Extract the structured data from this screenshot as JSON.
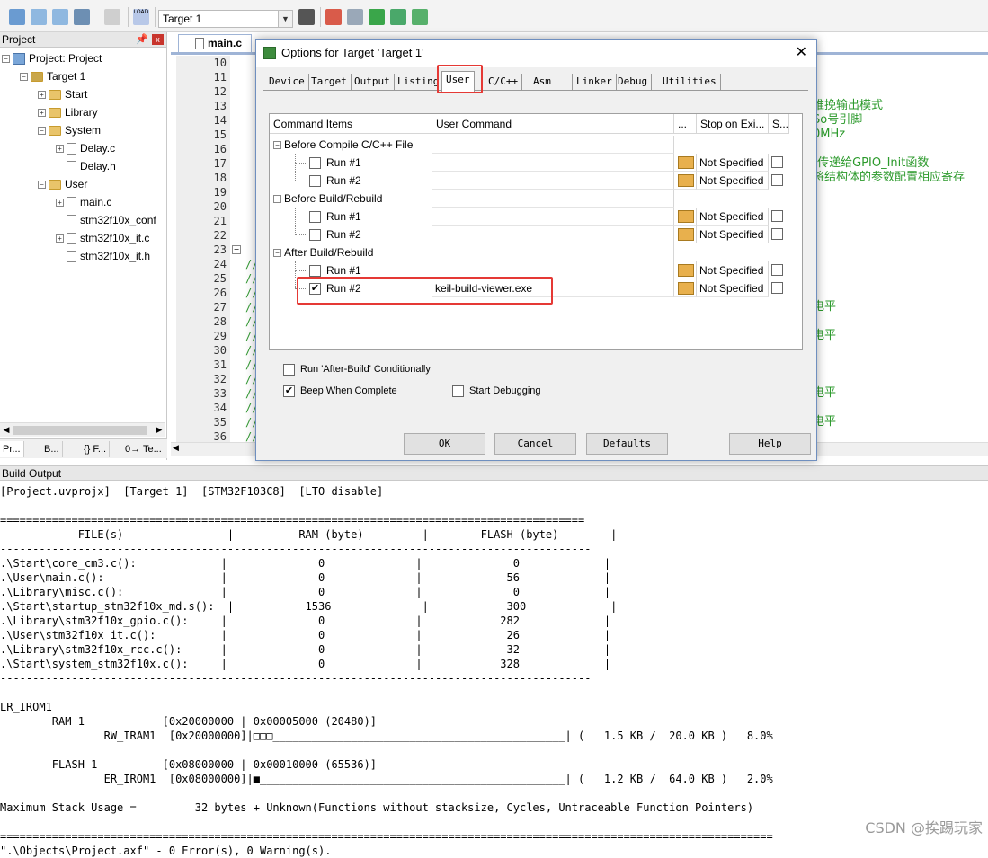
{
  "toolbar": {
    "target_value": "Target 1",
    "load_label": "LOAD"
  },
  "project_panel": {
    "title": "Project",
    "pin": "📌",
    "close": "x",
    "items": [
      {
        "label": "Project: Project",
        "expander": "−"
      },
      {
        "label": "Target 1",
        "expander": "−"
      },
      {
        "label": "Start",
        "expander": "+"
      },
      {
        "label": "Library",
        "expander": "+"
      },
      {
        "label": "System",
        "expander": "−"
      },
      {
        "label": "Delay.c",
        "expander": "+"
      },
      {
        "label": "Delay.h",
        "expander": ""
      },
      {
        "label": "User",
        "expander": "−"
      },
      {
        "label": "main.c",
        "expander": "+"
      },
      {
        "label": "stm32f10x_conf",
        "expander": ""
      },
      {
        "label": "stm32f10x_it.c",
        "expander": "+"
      },
      {
        "label": "stm32f10x_it.h",
        "expander": ""
      }
    ],
    "tabs": [
      "Pr...",
      "B...",
      "{} F...",
      "0→ Te..."
    ]
  },
  "editor": {
    "tab_label": "main.c",
    "line_numbers": [
      "10",
      "11",
      "12",
      "13",
      "14",
      "15",
      "16",
      "17",
      "18",
      "19",
      "20",
      "21",
      "22",
      "23",
      "24",
      "25",
      "26",
      "27",
      "28",
      "29",
      "30",
      "31",
      "32",
      "33",
      "34",
      "35",
      "36"
    ],
    "comment_marker": "//",
    "right_comments": [
      {
        "line": "13",
        "text": "推挽输出模式"
      },
      {
        "line": "14",
        "text": "So号引脚"
      },
      {
        "line": "15",
        "text": "0MHz"
      },
      {
        "line": "17",
        "text": "t传递给GPIO_Init函数"
      },
      {
        "line": "18",
        "text": "将结构体的参数配置相应寄存"
      },
      {
        "line": "27",
        "text": "电平"
      },
      {
        "line": "29",
        "text": "电平"
      },
      {
        "line": "33",
        "text": "电平"
      },
      {
        "line": "35",
        "text": "电平"
      }
    ]
  },
  "dialog": {
    "title": "Options for Target 'Target 1'",
    "close": "✕",
    "tabs": [
      "Device",
      "Target",
      "Output",
      "Listing",
      "User",
      "C/C++",
      "Asm",
      "Linker",
      "Debug",
      "Utilities"
    ],
    "active_tab": "User",
    "grid_headers": {
      "command_items": "Command Items",
      "user_command": "User Command",
      "dots": "...",
      "stop_on_exit": "Stop on Exi...",
      "s": "S..."
    },
    "groups": [
      {
        "label": "Before Compile C/C++ File",
        "expander": "−",
        "runs": [
          {
            "label": "Run #1",
            "checked": false,
            "command": "",
            "stop": "Not Specified"
          },
          {
            "label": "Run #2",
            "checked": false,
            "command": "",
            "stop": "Not Specified"
          }
        ]
      },
      {
        "label": "Before Build/Rebuild",
        "expander": "−",
        "runs": [
          {
            "label": "Run #1",
            "checked": false,
            "command": "",
            "stop": "Not Specified"
          },
          {
            "label": "Run #2",
            "checked": false,
            "command": "",
            "stop": "Not Specified"
          }
        ]
      },
      {
        "label": "After Build/Rebuild",
        "expander": "−",
        "runs": [
          {
            "label": "Run #1",
            "checked": false,
            "command": "",
            "stop": "Not Specified"
          },
          {
            "label": "Run #2",
            "checked": true,
            "command": "keil-build-viewer.exe",
            "stop": "Not Specified"
          }
        ]
      }
    ],
    "check_mark": "✔",
    "options": {
      "run_after_build_conditionally": {
        "label": "Run 'After-Build' Conditionally",
        "checked": false
      },
      "beep_when_complete": {
        "label": "Beep When Complete",
        "checked": true
      },
      "start_debugging": {
        "label": "Start Debugging",
        "checked": false
      }
    },
    "buttons": {
      "ok": "OK",
      "cancel": "Cancel",
      "defaults": "Defaults",
      "help": "Help"
    }
  },
  "build_output": {
    "title": "Build Output",
    "lines": [
      "[Project.uvprojx]  [Target 1]  [STM32F103C8]  [LTO disable]",
      "",
      "==========================================================================================",
      "            FILE(s)                |          RAM (byte)         |        FLASH (byte)        |",
      "-------------------------------------------------------------------------------------------",
      ".\\Start\\core_cm3.c():             |              0              |              0             |",
      ".\\User\\main.c():                  |              0              |             56             |",
      ".\\Library\\misc.c():               |              0              |              0             |",
      ".\\Start\\startup_stm32f10x_md.s():  |           1536              |            300             |",
      ".\\Library\\stm32f10x_gpio.c():     |              0              |            282             |",
      ".\\User\\stm32f10x_it.c():          |              0              |             26             |",
      ".\\Library\\stm32f10x_rcc.c():      |              0              |             32             |",
      ".\\Start\\system_stm32f10x.c():     |              0              |            328             |",
      "-------------------------------------------------------------------------------------------",
      "",
      "LR_IROM1",
      "        RAM 1            [0x20000000 | 0x00005000 (20480)]",
      "                RW_IRAM1  [0x20000000]|□□□_____________________________________________| (   1.5 KB /  20.0 KB )   8.0%",
      "",
      "        FLASH 1          [0x08000000 | 0x00010000 (65536)]",
      "                ER_IROM1  [0x08000000]|■_______________________________________________| (   1.2 KB /  64.0 KB )   2.0%",
      "",
      "Maximum Stack Usage =         32 bytes + Unknown(Functions without stacksize, Cycles, Untraceable Function Pointers)",
      "",
      "=======================================================================================================================",
      "\".\\Objects\\Project.axf\" - 0 Error(s), 0 Warning(s)."
    ],
    "watermark": "CSDN @挨踢玩家"
  },
  "colors": {
    "highlight_red": "#e53935",
    "comment_green": "#339933"
  }
}
